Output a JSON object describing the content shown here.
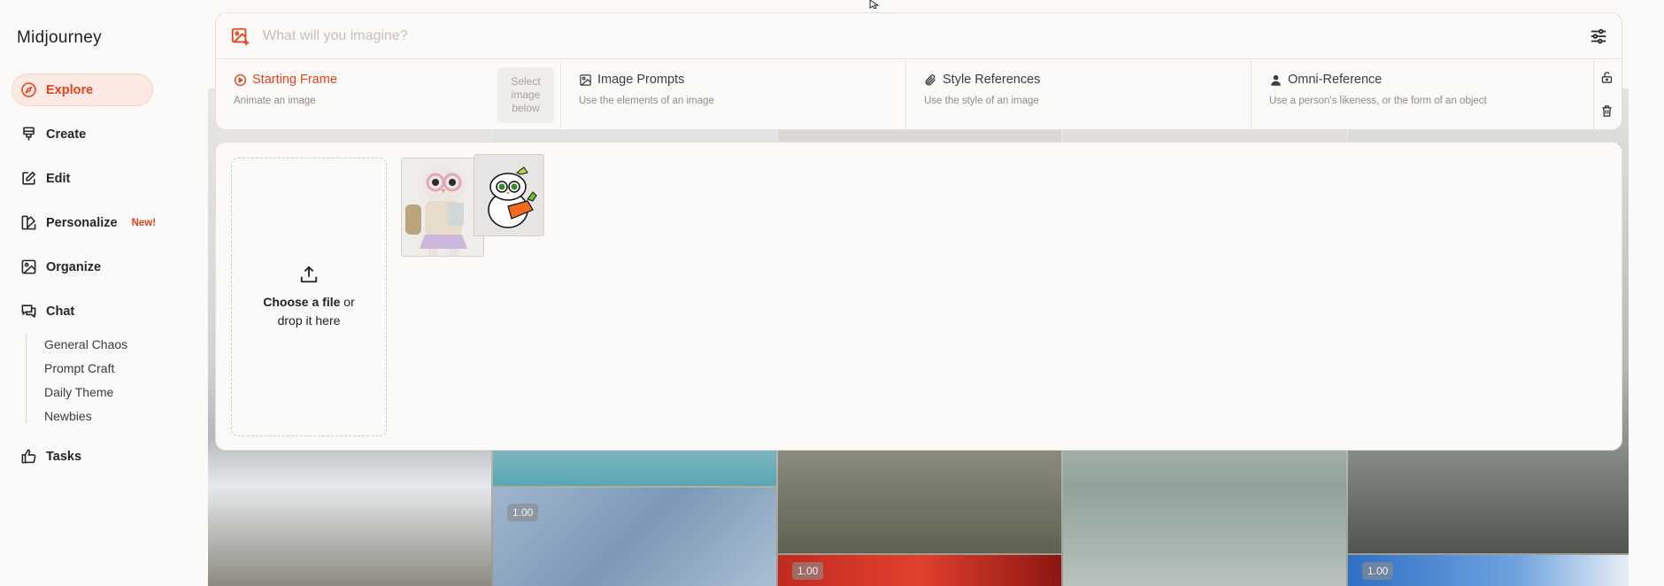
{
  "app": {
    "brand": "Midjourney"
  },
  "sidebar": {
    "items": [
      {
        "label": "Explore",
        "icon": "compass-icon",
        "active": true
      },
      {
        "label": "Create",
        "icon": "brush-icon"
      },
      {
        "label": "Edit",
        "icon": "edit-icon"
      },
      {
        "label": "Personalize",
        "icon": "palette-icon",
        "badge": "New!"
      },
      {
        "label": "Organize",
        "icon": "image-icon"
      },
      {
        "label": "Chat",
        "icon": "chat-icon"
      },
      {
        "label": "Tasks",
        "icon": "thumbs-up-icon"
      }
    ],
    "chat_rooms": [
      "General Chaos",
      "Prompt Craft",
      "Daily Theme",
      "Newbies"
    ]
  },
  "prompt": {
    "placeholder": "What will you imagine?",
    "sections": [
      {
        "title": "Starting Frame",
        "desc": "Animate an image",
        "icon": "play-circle-icon",
        "active": true,
        "hint": "Select image below"
      },
      {
        "title": "Image Prompts",
        "desc": "Use the elements of an image",
        "icon": "image-icon"
      },
      {
        "title": "Style References",
        "desc": "Use the style of an image",
        "icon": "paperclip-icon"
      },
      {
        "title": "Omni-Reference",
        "desc": "Use a person's likeness, or the form of an object",
        "icon": "person-icon"
      }
    ]
  },
  "upload": {
    "choose": "Choose a file",
    "or": " or",
    "drop": "drop it here"
  },
  "gallery": {
    "scores": [
      "1.00",
      "1.00",
      "1.00"
    ]
  },
  "colors": {
    "accent": "#e5431c",
    "background": "#fbfaf8"
  }
}
